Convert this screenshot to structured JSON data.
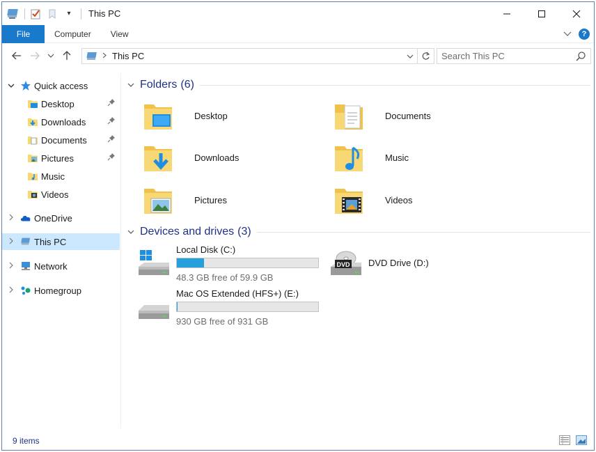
{
  "window": {
    "title": "This PC"
  },
  "ribbon": {
    "file_tab": "File",
    "tabs": [
      "Computer",
      "View"
    ],
    "help": "?"
  },
  "address": {
    "path": "This PC"
  },
  "search": {
    "placeholder": "Search This PC"
  },
  "nav": {
    "quick_access": "Quick access",
    "quick_items": [
      "Desktop",
      "Downloads",
      "Documents",
      "Pictures",
      "Music",
      "Videos"
    ],
    "onedrive": "OneDrive",
    "this_pc": "This PC",
    "network": "Network",
    "homegroup": "Homegroup"
  },
  "folders": {
    "title": "Folders",
    "count": "(6)",
    "items": [
      "Desktop",
      "Documents",
      "Downloads",
      "Music",
      "Pictures",
      "Videos"
    ]
  },
  "devices": {
    "title": "Devices and drives",
    "count": "(3)",
    "drives": [
      {
        "name": "Local Disk (C:)",
        "free": "48.3 GB free of 59.9 GB",
        "used_fraction": 0.19
      },
      {
        "name": "DVD Drive (D:)",
        "label": "DVD"
      },
      {
        "name": "Mac OS Extended (HFS+) (E:)",
        "free": "930 GB free of 931 GB",
        "used_fraction": 0.001
      }
    ]
  },
  "status": {
    "items": "9 items"
  },
  "colors": {
    "accent": "#1979ca",
    "selection": "#cce8ff",
    "group_title": "#1e3287",
    "drive_fill": "#26a0da",
    "folder": "#f8d775"
  }
}
